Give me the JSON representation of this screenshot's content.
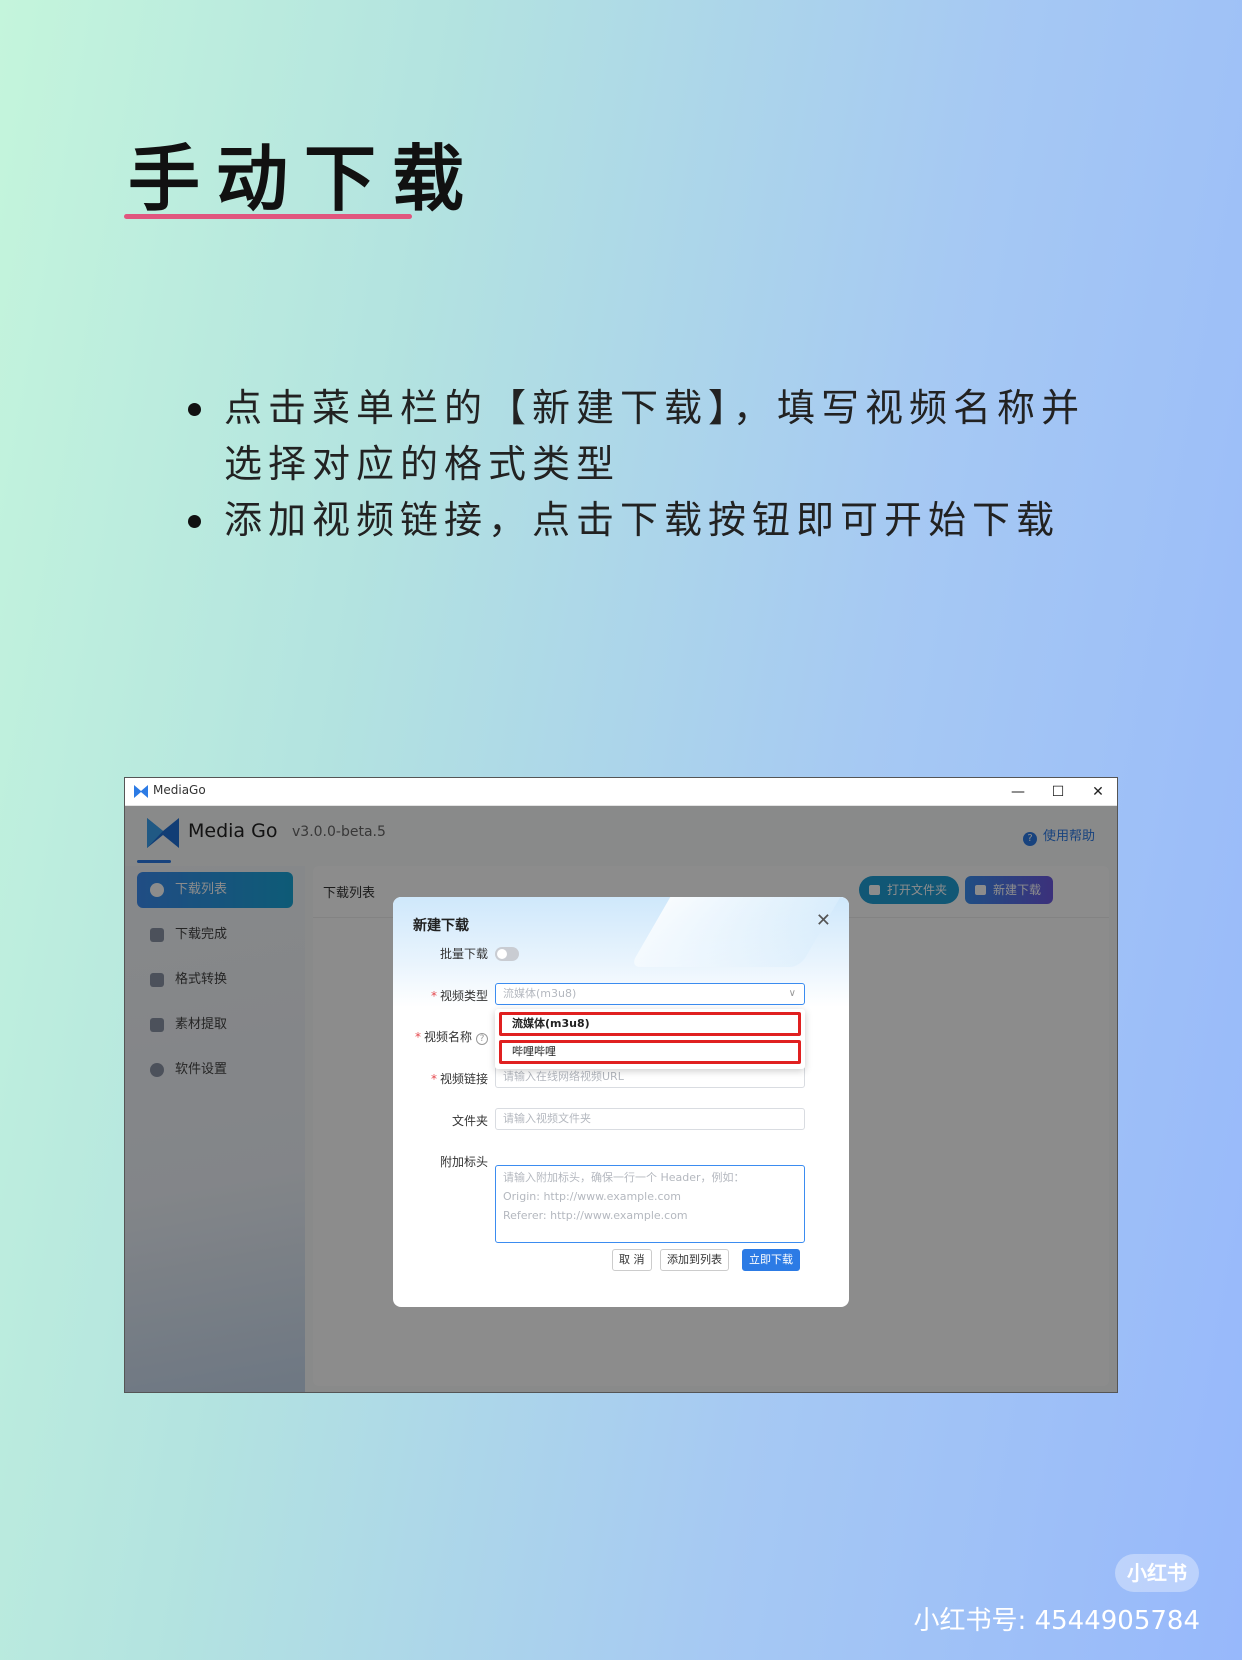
{
  "page": {
    "title": "手动下载",
    "bullets": [
      "点击菜单栏的【新建下载】，填写视频名称并选择对应的格式类型",
      "添加视频链接，点击下载按钮即可开始下载"
    ]
  },
  "window": {
    "title": "MediaGo",
    "controls": {
      "minimize": "—",
      "maximize": "☐",
      "close": "✕"
    }
  },
  "app": {
    "brand": "Media Go",
    "version": "v3.0.0-beta.5",
    "help": "使用帮助",
    "sidebar": {
      "items": [
        {
          "label": "下载列表",
          "icon": "cloud-download-icon",
          "active": true
        },
        {
          "label": "下载完成",
          "icon": "archive-icon",
          "active": false
        },
        {
          "label": "格式转换",
          "icon": "convert-icon",
          "active": false
        },
        {
          "label": "素材提取",
          "icon": "extract-icon",
          "active": false
        },
        {
          "label": "软件设置",
          "icon": "gear-icon",
          "active": false
        }
      ]
    },
    "main": {
      "title": "下载列表",
      "open_folder": "打开文件夹",
      "new_download": "新建下载"
    }
  },
  "dialog": {
    "title": "新建下载",
    "batch_label": "批量下载",
    "batch_enabled": false,
    "type_label": "视频类型",
    "type_value": "流媒体(m3u8)",
    "type_options": [
      "流媒体(m3u8)",
      "哔哩哔哩"
    ],
    "name_label": "视频名称",
    "url_label": "视频链接",
    "url_placeholder": "请输入在线网络视频URL",
    "folder_label": "文件夹",
    "folder_placeholder": "请输入视频文件夹",
    "headers_label": "附加标头",
    "headers_placeholder": [
      "请输入附加标头，确保一行一个 Header，例如：",
      "Origin: http://www.example.com",
      "Referer: http://www.example.com"
    ],
    "cancel": "取 消",
    "add_to_list": "添加到列表",
    "download_now": "立即下载"
  },
  "watermark": {
    "badge": "小红书",
    "text": "小红书号: 4544905784"
  },
  "colors": {
    "accent": "#2c7be5",
    "highlight": "#e02020",
    "title_underline": "#e0567e"
  }
}
